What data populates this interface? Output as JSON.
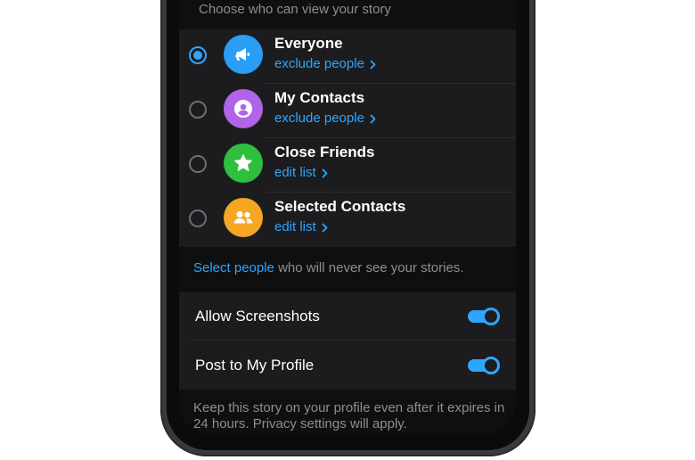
{
  "section_header": "Choose who can view your story",
  "options": [
    {
      "title": "Everyone",
      "link": "exclude people",
      "selected": true,
      "icon": "megaphone-icon",
      "color": "#2a9df4"
    },
    {
      "title": "My Contacts",
      "link": "exclude people",
      "selected": false,
      "icon": "person-icon",
      "color": "#b065e8"
    },
    {
      "title": "Close Friends",
      "link": "edit list",
      "selected": false,
      "icon": "star-icon",
      "color": "#2fbf3e"
    },
    {
      "title": "Selected Contacts",
      "link": "edit list",
      "selected": false,
      "icon": "group-icon",
      "color": "#f5a623"
    }
  ],
  "select_note": {
    "link": "Select people",
    "text": " who will never see your stories."
  },
  "toggles": [
    {
      "label": "Allow Screenshots",
      "on": true
    },
    {
      "label": "Post to My Profile",
      "on": true
    }
  ],
  "footer_note": "Keep this story on your profile even after it expires in 24 hours. Privacy settings will apply.",
  "colors": {
    "accent": "#2ea6ff",
    "background": "#0f0f10",
    "card": "#1c1c1e",
    "secondary_text": "#8e8e93"
  }
}
